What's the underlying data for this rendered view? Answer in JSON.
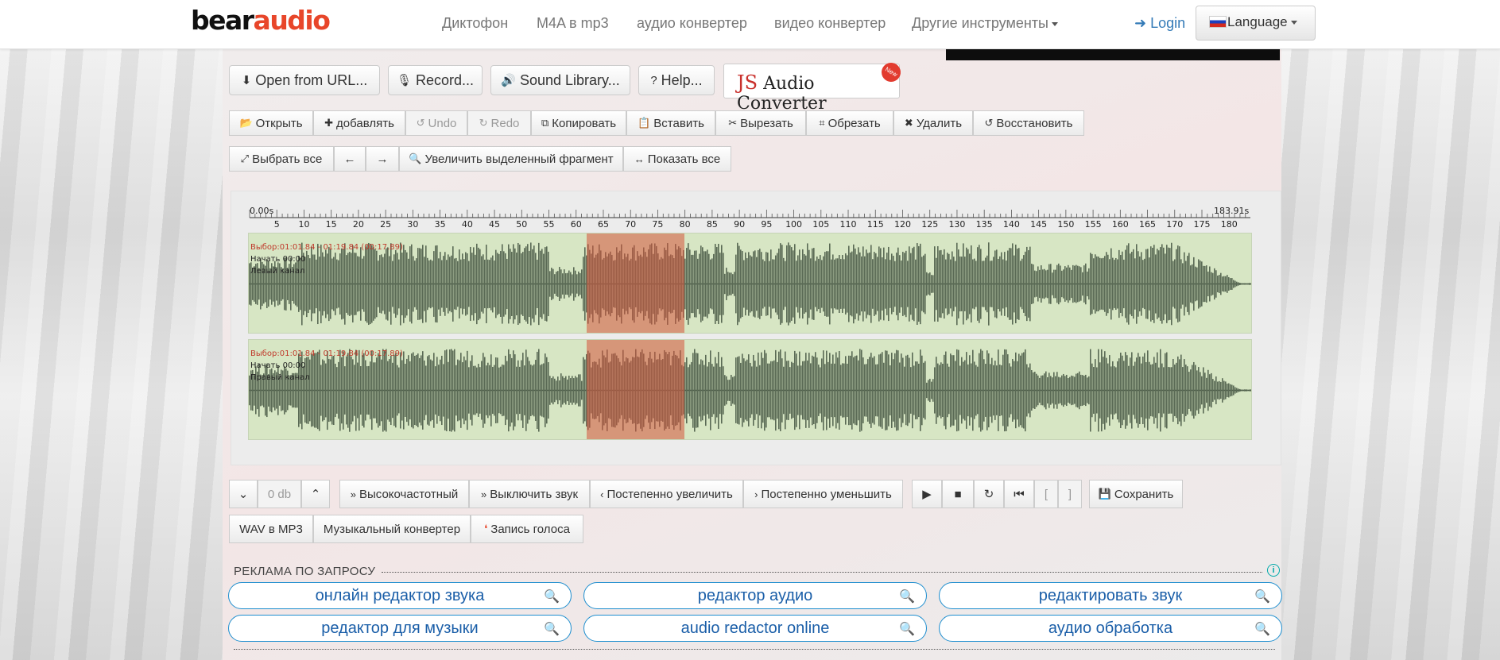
{
  "brand": {
    "part1": "bear",
    "part2": "audio"
  },
  "nav": {
    "items": [
      "Диктофон",
      "M4A в mp3",
      "аудио конвертер",
      "видео конвертер",
      "Другие инструменты"
    ],
    "login": "Login",
    "language": "Language"
  },
  "toolbar_top": {
    "open_url": "Open from URL...",
    "record": "Record...",
    "sound_library": "Sound Library...",
    "help": "Help...",
    "js_logo": {
      "js": "JS",
      "rest": "Audio Converter",
      "tag": "New"
    }
  },
  "toolbar_edit": {
    "open": "Открыть",
    "add": "добавлять",
    "undo": "Undo",
    "redo": "Redo",
    "copy": "Копировать",
    "paste": "Вставить",
    "cut": "Вырезать",
    "trim": "Обрезать",
    "delete": "Удалить",
    "restore": "Восстановить"
  },
  "toolbar_view": {
    "select_all": "Выбрать все",
    "left": "←",
    "right": "→",
    "zoom_selection": "Увеличить выделенный фрагмент",
    "show_all": "Показать все"
  },
  "timeline": {
    "start": "0.00s",
    "end": "183.91s",
    "ticks": [
      "5",
      "10",
      "15",
      "20",
      "25",
      "30",
      "35",
      "40",
      "45",
      "50",
      "55",
      "60",
      "65",
      "70",
      "75",
      "80",
      "85",
      "90",
      "95",
      "100",
      "105",
      "110",
      "115",
      "120",
      "125",
      "130",
      "135",
      "140",
      "145",
      "150",
      "155",
      "160",
      "165",
      "170",
      "175",
      "180"
    ],
    "duration_s": 183.91,
    "selection_start_s": 61.84,
    "selection_end_s": 79.84
  },
  "tracks": [
    {
      "selection": "Выбор:01:01.84 - 01:19.84 (00:17.89)",
      "start": "Начать 00:00",
      "channel": "Левый канал"
    },
    {
      "selection": "Выбор:01:01.84 - 01:19.84 (00:17.89)",
      "start": "Начать 00:00",
      "channel": "Правый канал"
    }
  ],
  "controls": {
    "volume": "0 db",
    "highpass": "Высокочастотный",
    "mute": "Выключить звук",
    "fade_in": "Постепенно увеличить",
    "fade_out": "Постепенно уменьшить",
    "bracket_open": "[",
    "bracket_close": "]",
    "save": "Сохранить"
  },
  "links": {
    "wav_mp3": "WAV в MP3",
    "music_converter": "Музыкальный конвертер",
    "voice_record": "Запись голоса"
  },
  "ads": {
    "title": "РЕКЛАМА ПО ЗАПРОСУ",
    "items": [
      "онлайн редактор звука",
      "редактор аудио",
      "редактировать звук",
      "редактор для музыки",
      "audio redactor online",
      "аудио обработка"
    ]
  },
  "colors": {
    "waveform": "#5a6a55",
    "track_bg": "#d7e6c4",
    "selection": "#d6543c",
    "link": "#337ab7",
    "brand_accent": "#e8462a"
  }
}
